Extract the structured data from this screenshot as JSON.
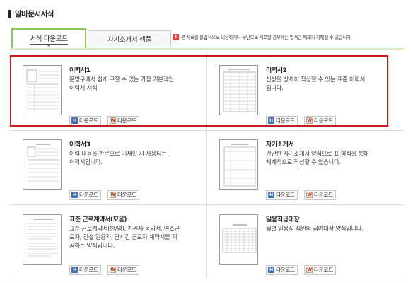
{
  "page_title": "알바문서서식",
  "tabs": [
    {
      "label": "서식 다운로드",
      "active": true
    },
    {
      "label": "자기소개서 샘플",
      "active": false
    }
  ],
  "notice": {
    "icon": "!",
    "text": "본 자료를 불법적으로 이용하거나 무단으로 배포할 경우에는 법적인 제재가 가해질 수 있습니다."
  },
  "cards": [
    {
      "title": "이력서1",
      "desc_lines": [
        "문방구에서 쉽게 구할 수 있는 가장 기본적인",
        "이력서 서식"
      ],
      "download_hwp": "다운로드",
      "download_doc": "다운로드"
    },
    {
      "title": "이력서2",
      "desc_lines": [
        "신상을 상세히 작성할 수 있는 표준 이력서",
        "입니다."
      ],
      "download_hwp": "다운로드",
      "download_doc": "다운로드"
    },
    {
      "title": "이력서3",
      "desc_lines": [
        "이력 내용을 한문으로 기재할 시 사용되는",
        "이력서입니다."
      ],
      "download_hwp": "다운로드",
      "download_doc": "다운로드"
    },
    {
      "title": "자기소개서",
      "desc_lines": [
        "간단한 자기소개서 양식으로 표 형식을 통해",
        "체계적으로 작성할 수 있습니다."
      ],
      "download_hwp": "다운로드",
      "download_doc": "다운로드"
    },
    {
      "title": "표준 근로계약서(모음)",
      "desc_lines": [
        "표준 근로계약서(한/영), 친권자 동의서, 연소근",
        "로자, 건설 일용자, 단시간 근로자 계약서를 제",
        "공하는 양식입니다."
      ],
      "download_hwp": "다운로드",
      "download_doc": "다운로드"
    },
    {
      "title": "일용직급대장",
      "desc_lines": [
        "월별 일용직 직원의 급여대장 양식입니다."
      ],
      "download_hwp": "다운로드",
      "download_doc": "다운로드"
    }
  ],
  "colors": {
    "accent_green": "#8ec95a",
    "highlight_red": "#cc1a1a",
    "hwp_blue": "#3b6fbf"
  }
}
